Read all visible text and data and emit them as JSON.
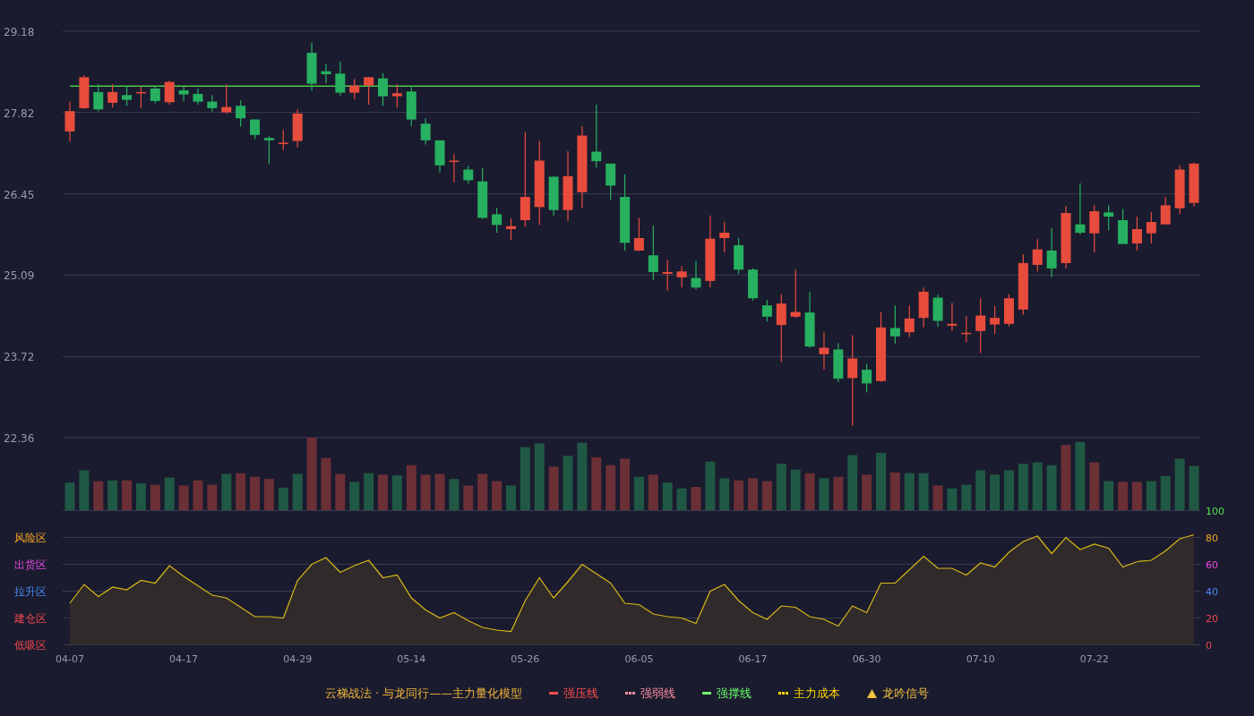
{
  "price_chart": {
    "chart_data": {
      "type": "candlestick",
      "grid": true,
      "ylim": [
        22.36,
        29.18
      ],
      "yticks": [
        {
          "value": 29.18,
          "label": "29.18"
        },
        {
          "value": 27.82,
          "label": "27.82"
        },
        {
          "value": 26.45,
          "label": "26.45"
        },
        {
          "value": 25.09,
          "label": "25.09"
        },
        {
          "value": 23.72,
          "label": "23.72"
        },
        {
          "value": 22.36,
          "label": "22.36"
        }
      ],
      "categories": [
        null,
        null,
        null,
        null,
        null,
        null,
        null,
        null,
        null,
        null,
        null,
        null,
        null,
        null,
        null,
        null,
        null,
        null,
        null,
        null,
        null,
        null,
        null,
        null,
        null,
        null,
        null,
        null,
        null,
        null,
        null,
        null,
        null,
        null,
        null,
        null,
        null,
        null,
        null,
        null,
        null,
        null,
        null,
        null,
        null,
        null,
        null,
        null,
        null,
        null,
        null,
        null,
        null,
        null,
        null,
        null,
        null,
        null,
        null,
        null,
        null,
        null,
        null,
        null,
        null,
        null,
        null,
        null,
        null,
        null,
        null,
        null,
        null,
        null,
        null,
        null,
        null,
        null,
        null,
        null
      ],
      "ohlc": [
        [
          27.5,
          28.0,
          27.33,
          27.84
        ],
        [
          27.89,
          28.44,
          27.88,
          28.41
        ],
        [
          28.16,
          28.29,
          27.84,
          27.87
        ],
        [
          27.98,
          28.29,
          27.9,
          28.16
        ],
        [
          28.11,
          28.25,
          27.93,
          28.03
        ],
        [
          28.15,
          28.25,
          27.89,
          28.16
        ],
        [
          28.22,
          28.25,
          27.97,
          28.01
        ],
        [
          27.99,
          28.35,
          27.95,
          28.33
        ],
        [
          28.19,
          28.25,
          28.01,
          28.12
        ],
        [
          28.13,
          28.22,
          27.95,
          28.0
        ],
        [
          28.0,
          28.11,
          27.83,
          27.89
        ],
        [
          27.82,
          28.29,
          27.8,
          27.91
        ],
        [
          27.93,
          28.02,
          27.58,
          27.72
        ],
        [
          27.7,
          27.7,
          27.37,
          27.44
        ],
        [
          27.39,
          27.42,
          26.95,
          27.35
        ],
        [
          27.29,
          27.52,
          27.19,
          27.31
        ],
        [
          27.34,
          27.87,
          27.23,
          27.8
        ],
        [
          28.82,
          28.99,
          28.18,
          28.3
        ],
        [
          28.51,
          28.64,
          28.31,
          28.46
        ],
        [
          28.47,
          28.67,
          28.1,
          28.15
        ],
        [
          28.15,
          28.38,
          28.04,
          28.27
        ],
        [
          28.27,
          28.41,
          27.95,
          28.41
        ],
        [
          28.39,
          28.48,
          27.93,
          28.09
        ],
        [
          28.09,
          28.29,
          27.9,
          28.14
        ],
        [
          28.17,
          28.26,
          27.59,
          27.7
        ],
        [
          27.63,
          27.72,
          27.28,
          27.35
        ],
        [
          27.35,
          27.35,
          26.81,
          26.93
        ],
        [
          26.99,
          27.12,
          26.65,
          27.01
        ],
        [
          26.86,
          26.92,
          26.62,
          26.68
        ],
        [
          26.66,
          26.89,
          26.03,
          26.05
        ],
        [
          26.11,
          26.22,
          25.8,
          25.93
        ],
        [
          25.86,
          26.04,
          25.68,
          25.91
        ],
        [
          26.01,
          27.49,
          25.9,
          26.4
        ],
        [
          26.23,
          27.34,
          25.93,
          27.01
        ],
        [
          26.74,
          26.74,
          26.09,
          26.18
        ],
        [
          26.18,
          27.17,
          26.0,
          26.75
        ],
        [
          26.48,
          27.59,
          26.21,
          27.43
        ],
        [
          27.16,
          27.95,
          26.89,
          27.0
        ],
        [
          26.96,
          26.96,
          26.35,
          26.59
        ],
        [
          26.4,
          26.78,
          25.5,
          25.63
        ],
        [
          25.5,
          26.05,
          25.49,
          25.71
        ],
        [
          25.42,
          25.92,
          25.0,
          25.14
        ],
        [
          25.11,
          25.35,
          24.83,
          25.14
        ],
        [
          25.05,
          25.24,
          24.88,
          25.15
        ],
        [
          25.04,
          25.33,
          24.85,
          24.88
        ],
        [
          24.99,
          26.09,
          24.88,
          25.7
        ],
        [
          25.71,
          25.98,
          25.47,
          25.8
        ],
        [
          25.59,
          25.71,
          25.11,
          25.18
        ],
        [
          25.18,
          25.2,
          24.66,
          24.7
        ],
        [
          24.58,
          24.67,
          24.31,
          24.39
        ],
        [
          24.25,
          24.77,
          23.63,
          24.61
        ],
        [
          24.39,
          25.18,
          24.37,
          24.47
        ],
        [
          24.46,
          24.81,
          23.87,
          23.89
        ],
        [
          23.76,
          24.13,
          23.5,
          23.87
        ],
        [
          23.84,
          23.95,
          23.29,
          23.35
        ],
        [
          23.36,
          24.08,
          22.56,
          23.69
        ],
        [
          23.5,
          23.6,
          23.12,
          23.27
        ],
        [
          23.31,
          24.47,
          23.3,
          24.21
        ],
        [
          24.2,
          24.58,
          23.94,
          24.06
        ],
        [
          24.13,
          24.58,
          24.05,
          24.36
        ],
        [
          24.37,
          24.88,
          24.21,
          24.81
        ],
        [
          24.71,
          24.76,
          24.22,
          24.32
        ],
        [
          24.24,
          24.62,
          24.15,
          24.27
        ],
        [
          24.11,
          24.4,
          23.96,
          24.12
        ],
        [
          24.15,
          24.7,
          23.78,
          24.41
        ],
        [
          24.26,
          24.57,
          24.1,
          24.37
        ],
        [
          24.27,
          24.77,
          24.23,
          24.7
        ],
        [
          24.51,
          25.44,
          24.42,
          25.29
        ],
        [
          25.26,
          25.69,
          25.15,
          25.52
        ],
        [
          25.5,
          25.88,
          25.05,
          25.2
        ],
        [
          25.29,
          26.25,
          25.2,
          26.13
        ],
        [
          25.94,
          26.63,
          25.77,
          25.8
        ],
        [
          25.79,
          26.26,
          25.47,
          26.16
        ],
        [
          26.14,
          26.26,
          25.84,
          26.07
        ],
        [
          26.01,
          26.2,
          25.61,
          25.61
        ],
        [
          25.62,
          26.07,
          25.5,
          25.86
        ],
        [
          25.79,
          26.14,
          25.62,
          25.98
        ],
        [
          25.94,
          26.4,
          25.94,
          26.26
        ],
        [
          26.21,
          26.93,
          26.11,
          26.86
        ],
        [
          26.3,
          26.98,
          26.24,
          26.96
        ]
      ],
      "ref_lines": [
        {
          "axis": "y",
          "value": 28.26,
          "color": "#4cc84a"
        }
      ]
    }
  },
  "indicator_chart": {
    "chart_data": {
      "type": "area",
      "grid": true,
      "ylim": [
        0,
        100
      ],
      "yticks": [
        {
          "value": 100,
          "label": "100"
        },
        {
          "value": 80,
          "label": "80"
        },
        {
          "value": 60,
          "label": "60"
        },
        {
          "value": 40,
          "label": "40"
        },
        {
          "value": 20,
          "label": "20"
        },
        {
          "value": 0,
          "label": "0"
        }
      ],
      "categories": [
        "04-07",
        null,
        null,
        null,
        null,
        null,
        null,
        null,
        "04-17",
        null,
        null,
        null,
        null,
        null,
        null,
        null,
        "04-29",
        null,
        null,
        null,
        null,
        null,
        null,
        null,
        "05-14",
        null,
        null,
        null,
        null,
        null,
        null,
        null,
        "05-26",
        null,
        null,
        null,
        null,
        null,
        null,
        null,
        "06-05",
        null,
        null,
        null,
        null,
        null,
        null,
        null,
        "06-17",
        null,
        null,
        null,
        null,
        null,
        null,
        null,
        "06-30",
        null,
        null,
        null,
        null,
        null,
        null,
        null,
        "07-10",
        null,
        null,
        null,
        null,
        null,
        null,
        null,
        "07-22",
        null,
        null,
        null,
        null,
        null,
        null,
        null
      ],
      "values": [
        31,
        45,
        36,
        43,
        41,
        48,
        46,
        59,
        51,
        44,
        37,
        35,
        28,
        21,
        21,
        20,
        48,
        60,
        65,
        54,
        59,
        63,
        50,
        52,
        35,
        26,
        20,
        24,
        18,
        13,
        11,
        10,
        33,
        50,
        35,
        47,
        60,
        53,
        46,
        31,
        30,
        23,
        21,
        20,
        16,
        40,
        45,
        33,
        24,
        19,
        29,
        28,
        21,
        19,
        14,
        29,
        24,
        46,
        46,
        56,
        66,
        57,
        57,
        52,
        61,
        58,
        69,
        77,
        81,
        68,
        80,
        71,
        75,
        72,
        58,
        62,
        63,
        70,
        79,
        82
      ],
      "annotations": [
        "风险区",
        "出货区",
        "拉升区",
        "建仓区",
        "低吸区"
      ]
    }
  },
  "legend": {
    "title": "云梯战法 · 与龙同行——主力量化模型",
    "items": [
      {
        "kind": "line",
        "label": "强压线",
        "color": "#ff4d4f"
      },
      {
        "kind": "dashed",
        "label": "强弱线",
        "color": "#ff8fa3"
      },
      {
        "kind": "line",
        "label": "强撑线",
        "color": "#6cff6c"
      },
      {
        "kind": "dashed",
        "label": "主力成本",
        "color": "#ffd700"
      },
      {
        "kind": "triangle",
        "label": "龙吟信号",
        "color": "#f5c242"
      }
    ]
  }
}
